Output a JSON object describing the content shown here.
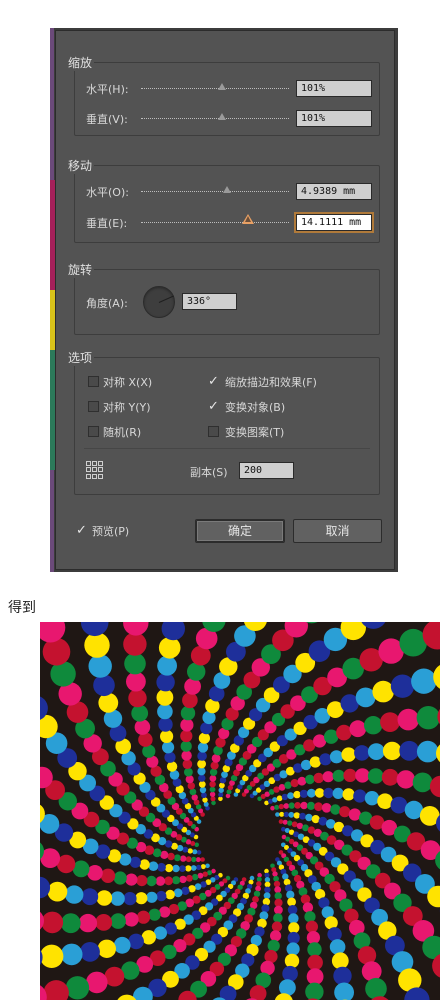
{
  "dialog": {
    "scale": {
      "title": "缩放",
      "horizontal": {
        "label": "水平(H):",
        "value": "101%",
        "level": 0.55
      },
      "vertical": {
        "label": "垂直(V):",
        "value": "101%",
        "level": 0.55
      }
    },
    "move": {
      "title": "移动",
      "horizontal": {
        "label": "水平(O):",
        "value": "4.9389 mm",
        "level": 0.58
      },
      "vertical": {
        "label": "垂直(E):",
        "value": "14.1111 mm",
        "level": 0.72
      }
    },
    "rotate": {
      "title": "旋转",
      "angle_label": "角度(A):",
      "angle_value": "336°"
    },
    "options": {
      "title": "选项",
      "mirror_x": {
        "label": "对称 X(X)",
        "checked": false
      },
      "mirror_y": {
        "label": "对称 Y(Y)",
        "checked": false
      },
      "random": {
        "label": "随机(R)",
        "checked": false
      },
      "scale_strokes": {
        "label": "缩放描边和效果(F)",
        "checked": true
      },
      "transform_objects": {
        "label": "变换对象(B)",
        "checked": true
      },
      "transform_patterns": {
        "label": "变换图案(T)",
        "checked": false
      },
      "copies_label": "副本(S)",
      "copies_value": "200"
    },
    "preview": {
      "label": "预览(P)",
      "checked": true
    },
    "ok_label": "确定",
    "cancel_label": "取消"
  },
  "caption": "得到",
  "artwork": {
    "background": "#1f1714",
    "dot_colors": [
      "#e8176f",
      "#ffe300",
      "#0f8a3c",
      "#1e2f9a",
      "#c4122f",
      "#2a9fd6"
    ]
  },
  "colors": {
    "dialog_bg": "#535353",
    "field_bg": "#cfcfcf",
    "focus_ring": "#b07a3a",
    "slider_active": "#e8a064"
  }
}
